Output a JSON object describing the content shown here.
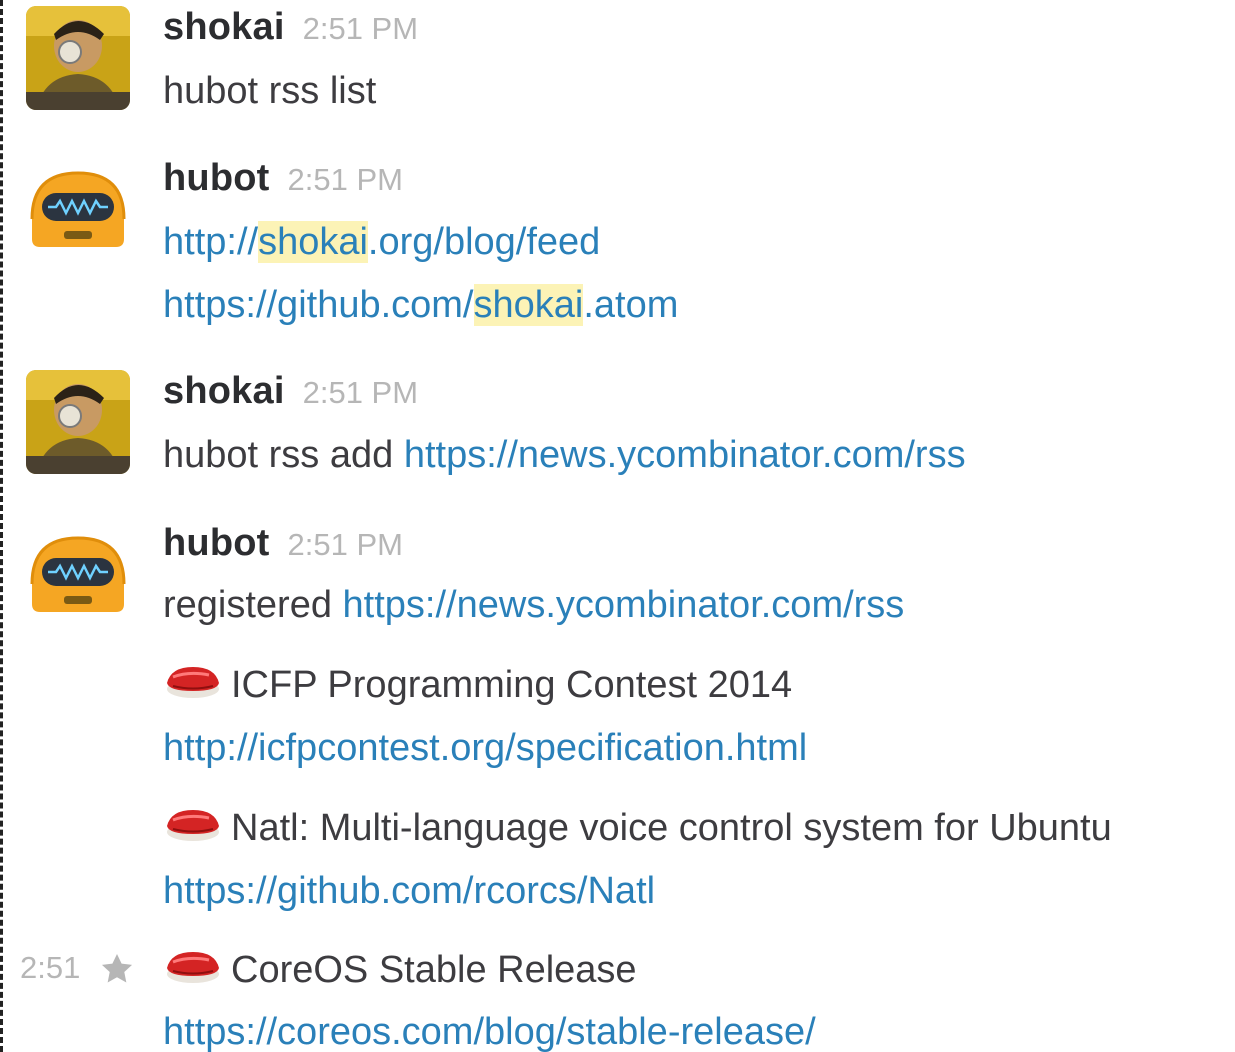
{
  "messages": [
    {
      "author": "shokai",
      "time": "2:51 PM",
      "text": "hubot rss list"
    },
    {
      "author": "hubot",
      "time": "2:51 PM",
      "links": [
        {
          "pre": "http://",
          "highlight": "shokai",
          "post": ".org/blog/feed"
        },
        {
          "pre": "https://github.com/",
          "highlight": "shokai",
          "post": ".atom"
        }
      ]
    },
    {
      "author": "shokai",
      "time": "2:51 PM",
      "text": "hubot rss add",
      "link": "https://news.ycombinator.com/rss"
    },
    {
      "author": "hubot",
      "time": "2:51 PM",
      "text": "registered",
      "link": "https://news.ycombinator.com/rss",
      "entries": [
        {
          "title": "ICFP Programming Contest 2014",
          "url": "http://icfpcontest.org/specification.html"
        },
        {
          "title": "Natl: Multi-language voice control system for Ubuntu",
          "url": "https://github.com/rcorcs/Natl"
        },
        {
          "title": "CoreOS Stable Release",
          "url": "https://coreos.com/blog/stable-release/"
        }
      ]
    }
  ],
  "hover_time": "2:51",
  "icons": {
    "shokai_avatar": "user-avatar-icon",
    "hubot_avatar": "robot-avatar-icon",
    "entry_emoji": "sushi-icon",
    "star": "star-icon"
  },
  "colors": {
    "link": "#2a80b9",
    "highlight": "#fcf3b6",
    "timestamp": "#b6b6b6",
    "author": "#2c2d30",
    "text": "#3d3c40",
    "sushi": "#d42424",
    "hubot_body": "#f5a623"
  }
}
